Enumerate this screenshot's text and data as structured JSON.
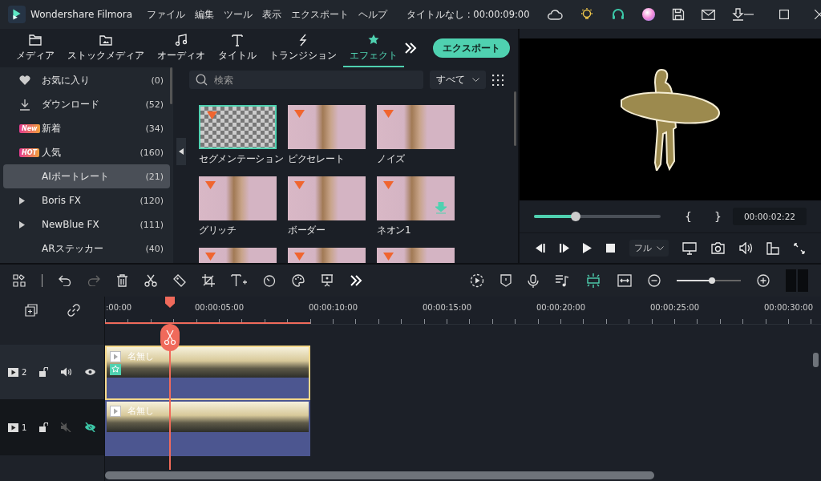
{
  "window": {
    "app_name": "Wondershare Filmora",
    "project_title": "タイトルなし : 00:00:09:00"
  },
  "menu": [
    "ファイル",
    "編集",
    "ツール",
    "表示",
    "エクスポート",
    "ヘルプ"
  ],
  "tabs": [
    {
      "kind": "media",
      "label": "メディア",
      "selected": false
    },
    {
      "kind": "stock",
      "label": "ストックメディア",
      "selected": false
    },
    {
      "kind": "audio",
      "label": "オーディオ",
      "selected": false
    },
    {
      "kind": "title",
      "label": "タイトル",
      "selected": false
    },
    {
      "kind": "transition",
      "label": "トランジション",
      "selected": false
    },
    {
      "kind": "effect",
      "label": "エフェクト",
      "selected": true
    }
  ],
  "export_button": "エクスポート",
  "sidebar": {
    "items": [
      {
        "kind": "heart",
        "label": "お気に入り",
        "count": "(0)",
        "selected": false
      },
      {
        "kind": "download",
        "label": "ダウンロード",
        "count": "(52)",
        "selected": false
      },
      {
        "kind": "badge",
        "badge": "New",
        "label": "新着",
        "count": "(34)",
        "selected": false
      },
      {
        "kind": "badge",
        "badge": "HOT",
        "label": "人気",
        "count": "(160)",
        "selected": false
      },
      {
        "kind": "plain",
        "label": "AIポートレート",
        "count": "(21)",
        "selected": true
      },
      {
        "kind": "folder",
        "label": "Boris FX",
        "count": "(120)",
        "selected": false
      },
      {
        "kind": "folder",
        "label": "NewBlue FX",
        "count": "(111)",
        "selected": false
      },
      {
        "kind": "plain",
        "label": "ARステッカー",
        "count": "(40)",
        "selected": false
      }
    ]
  },
  "search": {
    "placeholder": "検索"
  },
  "filter": {
    "value": "すべて"
  },
  "effects": [
    {
      "kind": "cutout",
      "label": "セグメンテーション",
      "selected": true,
      "downloadable": false
    },
    {
      "kind": "photo",
      "label": "ピクセレート",
      "selected": false,
      "downloadable": false
    },
    {
      "kind": "photo",
      "label": "ノイズ",
      "selected": false,
      "downloadable": false
    },
    {
      "kind": "photo",
      "label": "グリッチ",
      "selected": false,
      "downloadable": false
    },
    {
      "kind": "photo",
      "label": "ボーダー",
      "selected": false,
      "downloadable": false
    },
    {
      "kind": "photo",
      "label": "ネオン1",
      "selected": false,
      "downloadable": true
    },
    {
      "kind": "photo",
      "selected": false
    },
    {
      "kind": "photo",
      "selected": false
    },
    {
      "kind": "photo",
      "selected": false
    }
  ],
  "preview": {
    "level": 0.33,
    "in_mark": "{",
    "out_mark": "}",
    "time": "00:00:02:22",
    "quality": "フル"
  },
  "zoom": {
    "level": 0.55
  },
  "ruler": [
    ":00:00",
    "00:00:05:00",
    "00:00:10:00",
    "00:00:15:00",
    "00:00:20:00",
    "00:00:25:00",
    "00:00:30:00"
  ],
  "tracks": [
    {
      "number": "2",
      "muted": false,
      "hidden": false,
      "selected": true,
      "has_effect": true,
      "clip_title": "名無し"
    },
    {
      "number": "1",
      "muted": true,
      "hidden": true,
      "selected": false,
      "has_effect": false,
      "clip_title": "名無し"
    }
  ]
}
